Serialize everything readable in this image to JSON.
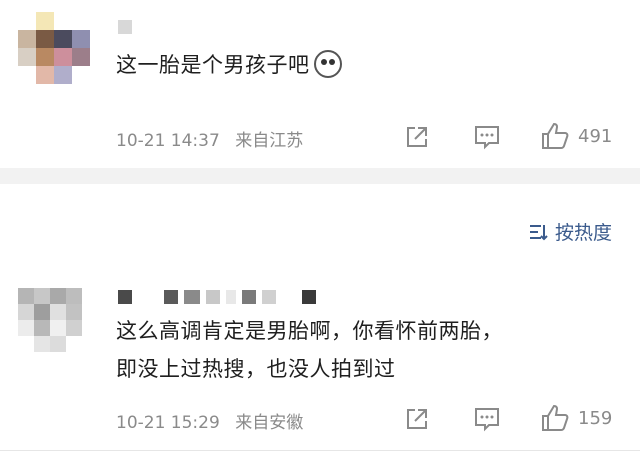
{
  "comments": [
    {
      "text": "这一胎是个男孩子吧",
      "emoji": "husky-emoji",
      "timestamp": "10-21 14:37",
      "location": "来自江苏",
      "likes": "491"
    },
    {
      "text_line1": "这么高调肯定是男胎啊，你看怀前两胎，",
      "text_line2": "即没上过热搜，也没人拍到过",
      "timestamp": "10-21 15:29",
      "location": "来自安徽",
      "likes": "159"
    }
  ],
  "sort": {
    "label": "按热度",
    "icon": "sort-icon"
  },
  "icons": [
    "share-icon",
    "comment-icon",
    "like-icon"
  ],
  "colors": {
    "meta": "#8a8a8a",
    "sort": "#3a5a8c",
    "divider": "#f2f2f2"
  }
}
